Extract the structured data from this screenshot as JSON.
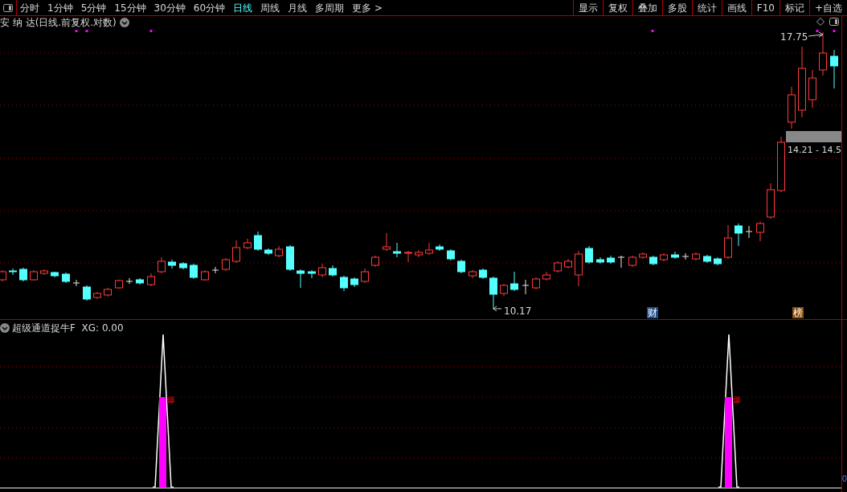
{
  "toolbar": {
    "periods": [
      {
        "label": "分时",
        "selected": false
      },
      {
        "label": "1分钟",
        "selected": false
      },
      {
        "label": "5分钟",
        "selected": false
      },
      {
        "label": "15分钟",
        "selected": false
      },
      {
        "label": "30分钟",
        "selected": false
      },
      {
        "label": "60分钟",
        "selected": false
      },
      {
        "label": "日线",
        "selected": true
      },
      {
        "label": "周线",
        "selected": false
      },
      {
        "label": "月线",
        "selected": false
      },
      {
        "label": "多周期",
        "selected": false
      },
      {
        "label": "更多 >",
        "selected": false
      }
    ],
    "buttons": [
      "显示",
      "复权",
      "叠加",
      "多股",
      "统计",
      "画线",
      "F10",
      "标记",
      "+自选"
    ]
  },
  "price_panel": {
    "title": "安 纳 达(日线.前复权.对数)",
    "high_label": "17.75",
    "low_label": "10.17",
    "range_label": "14.21 - 14.5",
    "markers": [
      {
        "label": "财",
        "color": "#1f4e8c"
      },
      {
        "label": "榜",
        "color": "#8a4b0a"
      }
    ]
  },
  "indicator_panel": {
    "title": "超级通道捉牛F  XG: 0.00",
    "signal_labels": [
      "爆",
      "爆"
    ],
    "axis_label": "0"
  }
}
